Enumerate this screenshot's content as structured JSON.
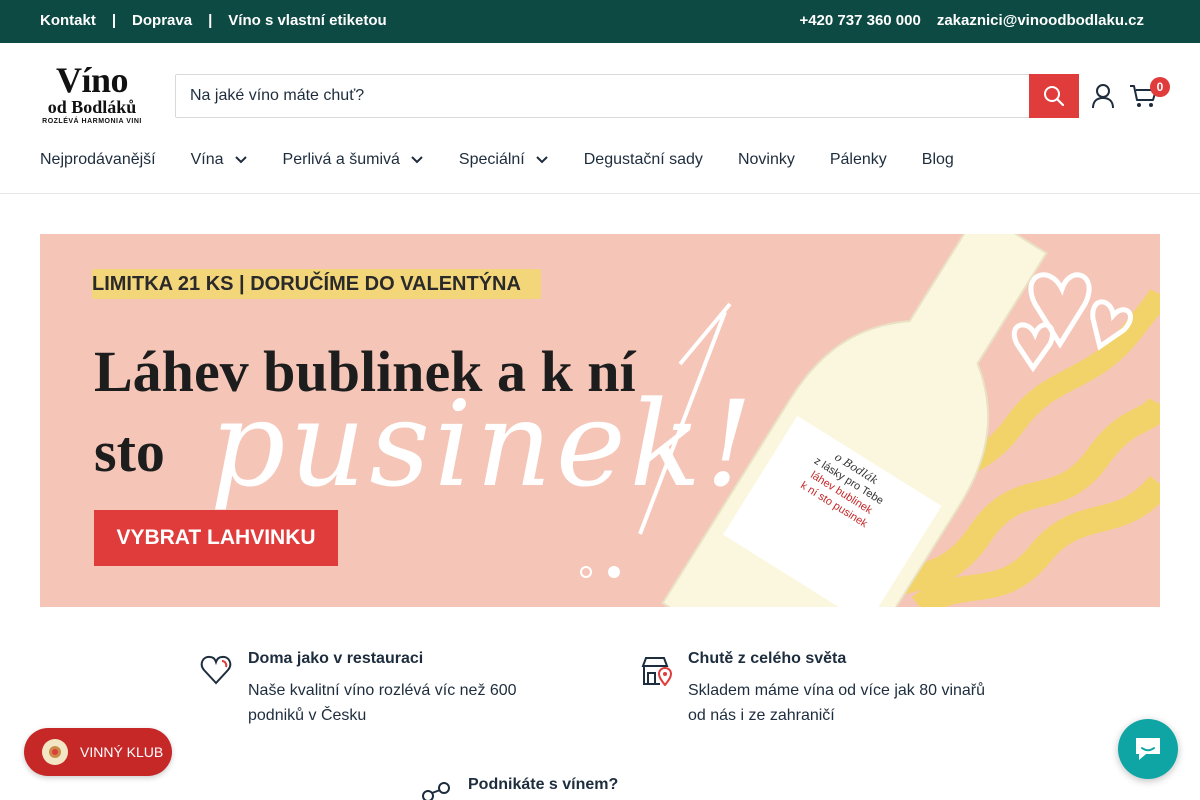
{
  "topbar": {
    "links": [
      "Kontakt",
      "Doprava",
      "Víno s vlastní etiketou"
    ],
    "separator": "|",
    "phone": "+420 737 360 000",
    "email": "zakaznici@vinoodbodlaku.cz"
  },
  "logo": {
    "line1": "Víno",
    "line2": "od Bodláků",
    "tagline": "ROZLÉVÁ HARMONIA VINI"
  },
  "search": {
    "placeholder": "Na jaké víno máte chuť?",
    "icon": "search-icon"
  },
  "cart": {
    "count": "0"
  },
  "nav": {
    "items": [
      {
        "label": "Nejprodávanější",
        "dropdown": false
      },
      {
        "label": "Vína",
        "dropdown": true
      },
      {
        "label": "Perlivá a šumivá",
        "dropdown": true
      },
      {
        "label": "Speciální",
        "dropdown": true
      },
      {
        "label": "Degustační sady",
        "dropdown": false
      },
      {
        "label": "Novinky",
        "dropdown": false
      },
      {
        "label": "Pálenky",
        "dropdown": false
      },
      {
        "label": "Blog",
        "dropdown": false
      }
    ]
  },
  "hero": {
    "pill": "LIMITKA 21 KS | DORUČÍME DO VALENTÝNA",
    "headline_line1": "Láhev bublinek a k ní",
    "headline_line2": "sto",
    "script_word": "pusinek!",
    "cta": "VYBRAT LAHVINKU",
    "bottle_label_brand": "o Bodlák",
    "bottle_label_line1": "z lásky pro Tebe",
    "bottle_label_line2": "láhev bublinek",
    "bottle_label_line3": "k ní sto pusinek",
    "slides_total": 2,
    "slide_active": 2
  },
  "features": [
    {
      "title": "Doma jako v restauraci",
      "desc": "Naše kvalitní víno rozlévá víc než 600 podniků v Česku",
      "icon": "heart-icon"
    },
    {
      "title": "Chutě z celého světa",
      "desc": "Skladem máme vína od více jak 80 vinařů od nás i ze zahraničí",
      "icon": "shop-location-icon"
    },
    {
      "title": "Podnikáte s vínem?",
      "desc": "",
      "icon": "network-icon"
    }
  ],
  "club": {
    "label": "VINNÝ KLUB"
  },
  "colors": {
    "topbar": "#0e4a44",
    "accent": "#e03c3c",
    "hero_bg": "#f5c6b8",
    "chat": "#0ea5a4"
  }
}
